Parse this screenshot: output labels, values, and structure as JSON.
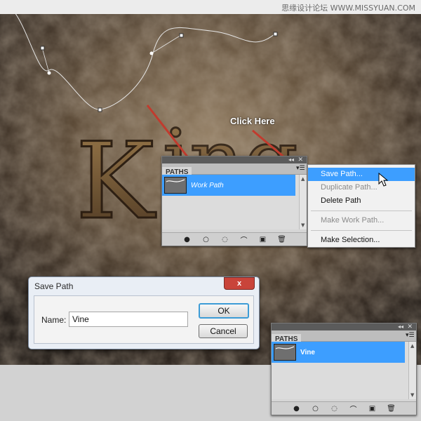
{
  "watermark": "思缘设计论坛 WWW.MISSYUAN.COM",
  "annotation": {
    "click_here": "Click Here"
  },
  "colors": {
    "selection": "#3d9eff",
    "arrow": "#c13b2e"
  },
  "paths_panel": {
    "tab": "PATHS",
    "rows": [
      {
        "label": "Work Path",
        "selected": true
      }
    ],
    "footer_icons": [
      "fill-path-icon",
      "stroke-path-icon",
      "load-selection-icon",
      "make-work-path-icon",
      "new-path-icon",
      "delete-path-icon"
    ]
  },
  "context_menu": {
    "items": [
      {
        "label": "Save Path...",
        "highlighted": true,
        "enabled": true
      },
      {
        "label": "Duplicate Path...",
        "enabled": false
      },
      {
        "label": "Delete Path",
        "enabled": true
      },
      {
        "label": "Make Work Path...",
        "enabled": false
      },
      {
        "label": "Make Selection...",
        "enabled": true
      }
    ]
  },
  "save_dialog": {
    "title": "Save Path",
    "name_label": "Name:",
    "name_value": "Vine",
    "ok_label": "OK",
    "cancel_label": "Cancel",
    "close_label": "x"
  },
  "paths_panel_result": {
    "tab": "PATHS",
    "rows": [
      {
        "label": "Vine",
        "selected": true
      }
    ]
  }
}
